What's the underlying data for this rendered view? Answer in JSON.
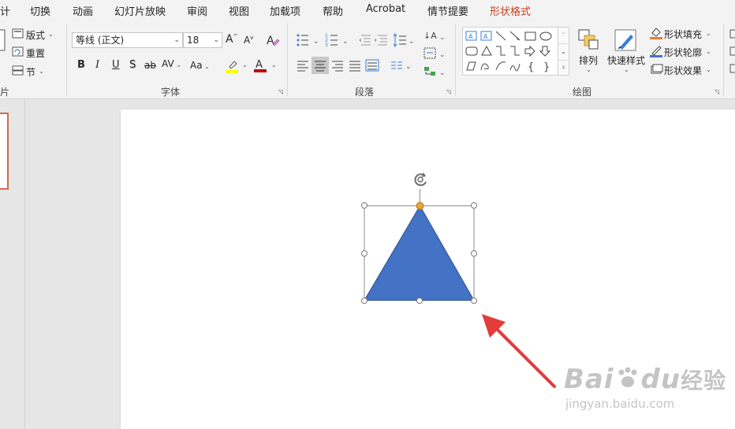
{
  "tabs": [
    {
      "label": "计",
      "active": false
    },
    {
      "label": "切换",
      "active": false
    },
    {
      "label": "动画",
      "active": false
    },
    {
      "label": "幻灯片放映",
      "active": false
    },
    {
      "label": "审阅",
      "active": false
    },
    {
      "label": "视图",
      "active": false
    },
    {
      "label": "加载项",
      "active": false
    },
    {
      "label": "帮助",
      "active": false
    },
    {
      "label": "Acrobat",
      "active": false
    },
    {
      "label": "情节提要",
      "active": false
    },
    {
      "label": "形状格式",
      "active": true
    }
  ],
  "slides_group": {
    "layout": "版式",
    "reset": "重置",
    "section": "节",
    "label_fragment": "片"
  },
  "font_group": {
    "font_name": "等线 (正文)",
    "font_size": "18",
    "label": "字体",
    "bold": "B",
    "italic": "I",
    "underline": "U",
    "shadow": "S",
    "strike": "ab",
    "spacing": "AV",
    "case": "Aa",
    "grow": "A",
    "shrink": "A"
  },
  "paragraph_group": {
    "label": "段落"
  },
  "drawing_group": {
    "label": "绘图",
    "arrange": "排列",
    "quick_styles": "快速样式",
    "shape_fill": "形状填充",
    "shape_outline": "形状轮廓",
    "shape_effects": "形状效果"
  },
  "colors": {
    "accent": "#c43e1c",
    "triangle_fill": "#4472c4",
    "triangle_stroke": "#2f528f",
    "adjust_handle": "#e8a33c",
    "arrow": "#e43b3b",
    "highlight_yellow": "#ffff00",
    "font_red": "#c00000"
  },
  "watermark": {
    "brand": "Bai",
    "brand2": "du",
    "cn": "经验",
    "url": "jingyan.baidu.com"
  }
}
